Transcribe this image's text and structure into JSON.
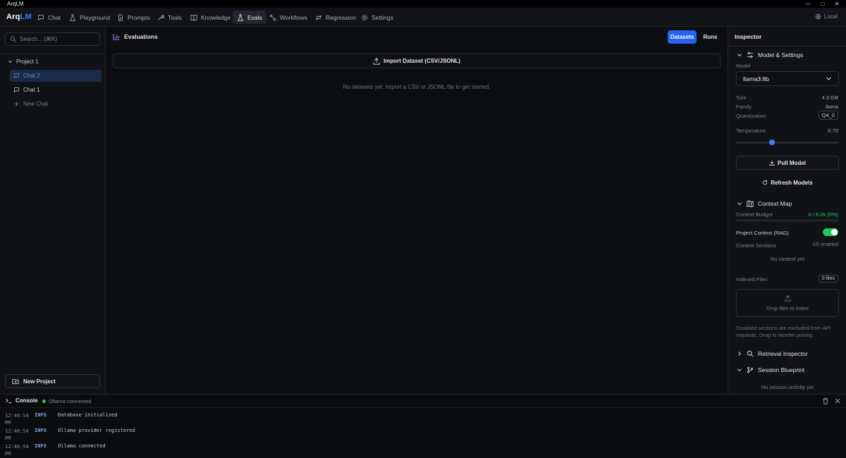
{
  "window": {
    "title": "ArqLM"
  },
  "logo": {
    "prefix": "Arq",
    "suffix": "LM"
  },
  "nav": {
    "items": [
      {
        "label": "Chat",
        "icon": "chat-bubble-icon"
      },
      {
        "label": "Playground",
        "icon": "flask-icon"
      },
      {
        "label": "Prompts",
        "icon": "document-icon"
      },
      {
        "label": "Tools",
        "icon": "wrench-icon"
      },
      {
        "label": "Knowledge",
        "icon": "book-icon"
      },
      {
        "label": "Evals",
        "icon": "beaker-icon"
      },
      {
        "label": "Workflows",
        "icon": "workflow-icon"
      },
      {
        "label": "Regression",
        "icon": "swap-icon"
      },
      {
        "label": "Settings",
        "icon": "gear-icon"
      }
    ],
    "active": "Evals",
    "mode_label": "Local"
  },
  "sidebar": {
    "search_placeholder": "Search... (⌘K)",
    "project": {
      "name": "Project 1"
    },
    "chats": [
      {
        "label": "Chat 2",
        "selected": true
      },
      {
        "label": "Chat 1",
        "selected": false
      }
    ],
    "new_chat_label": "New Chat",
    "new_project_label": "New Project"
  },
  "main": {
    "title": "Evaluations",
    "tabs": {
      "datasets": "Datasets",
      "runs": "Runs"
    },
    "active_tab": "Datasets",
    "import_label": "Import Dataset (CSV/JSONL)",
    "empty_message": "No datasets yet. Import a CSV or JSONL file to get started."
  },
  "inspector": {
    "title": "Inspector",
    "model_section": {
      "title": "Model & Settings",
      "model_label": "Model",
      "model_value": "llama3:8b",
      "size_label": "Size",
      "size_value": "4.3 GB",
      "family_label": "Family",
      "family_value": "llama",
      "quant_label": "Quantization",
      "quant_value": "Q4_0",
      "temp_label": "Temperature",
      "temp_value": "0.70",
      "temperature": 0.7,
      "temperature_max": 2.0,
      "pull_label": "Pull Model",
      "refresh_label": "Refresh Models"
    },
    "context_section": {
      "title": "Context Map",
      "budget_label": "Context Budget",
      "budget_value": "0 / 8.2k (0%)",
      "budget_fraction": 0,
      "rag_label": "Project Context (RAG)",
      "rag_enabled": true,
      "sections_label": "Context Sections",
      "sections_value": "0/0 enabled",
      "empty_label": "No context yet",
      "indexed_label": "Indexed Files",
      "indexed_value": "0 files",
      "drop_label": "Drop files to index",
      "note": "Disabled sections are excluded from API requests. Drag to reorder priority."
    },
    "retrieval_title": "Retrieval Inspector",
    "session_title": "Session Blueprint",
    "session_empty": "No session activity yet"
  },
  "console": {
    "title": "Console",
    "status": "Ollama connected",
    "logs": [
      {
        "time": "12:40:54 PM",
        "level": "INFO",
        "message": "Database initialized"
      },
      {
        "time": "12:40:54 PM",
        "level": "INFO",
        "message": "Ollama provider registered"
      },
      {
        "time": "12:40:54 PM",
        "level": "INFO",
        "message": "Ollama connected"
      }
    ]
  },
  "colors": {
    "accent": "#2563eb",
    "success": "#22c55e",
    "background": "#0d0e11"
  }
}
